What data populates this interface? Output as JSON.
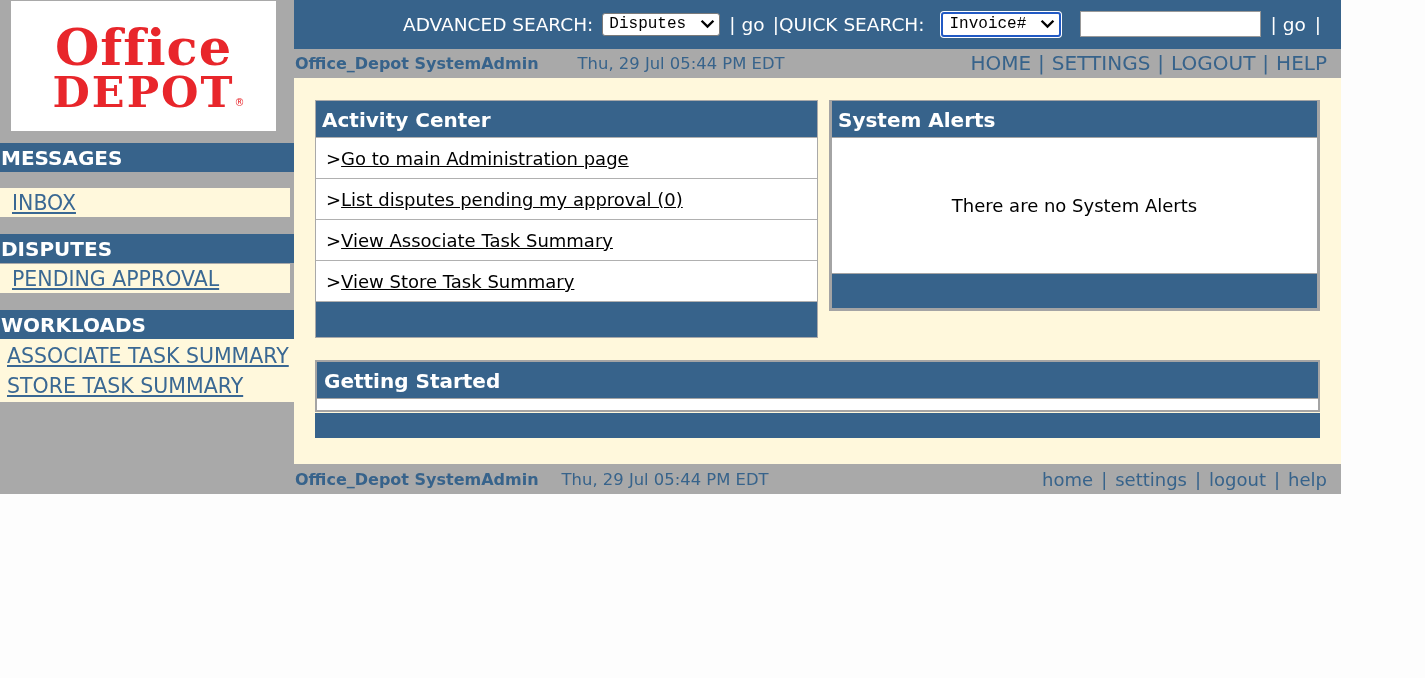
{
  "logo": {
    "line_1": "Office",
    "line_2": "DEPOT",
    "mark": "®"
  },
  "sidebar": {
    "sections": [
      {
        "title": "MESSAGES",
        "kind": "spaced",
        "items": [
          {
            "label": "INBOX"
          }
        ]
      },
      {
        "title": "DISPUTES",
        "kind": "inset",
        "items": [
          {
            "label": "PENDING APPROVAL"
          }
        ]
      },
      {
        "title": "WORKLOADS",
        "kind": "full",
        "items": [
          {
            "label": "ASSOCIATE TASK SUMMARY"
          },
          {
            "label": "STORE TASK SUMMARY"
          }
        ]
      }
    ]
  },
  "search_bar": {
    "advanced": {
      "label": "ADVANCED SEARCH:",
      "value": "Disputes",
      "focused": false
    },
    "advanced_go": {
      "before": "|",
      "label": "go",
      "after": "|"
    },
    "quick": {
      "label": "QUICK SEARCH:",
      "value": "Invoice#",
      "focused": true
    },
    "quick_go": {
      "before": "|",
      "label": "go",
      "after": "|"
    }
  },
  "user_bar": {
    "user": "Office_Depot SystemAdmin",
    "datetime": "Thu, 29 Jul 05:44 PM EDT",
    "links": [
      {
        "label": "HOME",
        "separator": "|"
      },
      {
        "label": "SETTINGS",
        "separator": "|"
      },
      {
        "label": "LOGOUT",
        "separator": "|"
      },
      {
        "label": "HELP"
      }
    ]
  },
  "activity_center": {
    "title": "Activity Center",
    "items": [
      {
        "prefix": ">",
        "label": "Go to main Administration page"
      },
      {
        "prefix": ">",
        "label": "List disputes pending my approval (0)"
      },
      {
        "prefix": ">",
        "label": "View Associate Task Summary"
      },
      {
        "prefix": ">",
        "label": "View Store Task Summary"
      }
    ]
  },
  "system_alerts": {
    "title": "System Alerts",
    "message": "There are no System Alerts"
  },
  "getting_started": {
    "title": "Getting Started"
  },
  "footer": {
    "user": "Office_Depot SystemAdmin",
    "datetime": "Thu, 29 Jul 05:44 PM EDT",
    "links": [
      {
        "label": "home",
        "separator": "|"
      },
      {
        "label": "settings",
        "separator": "|"
      },
      {
        "label": "logout",
        "separator": "|"
      },
      {
        "label": "help"
      }
    ]
  }
}
